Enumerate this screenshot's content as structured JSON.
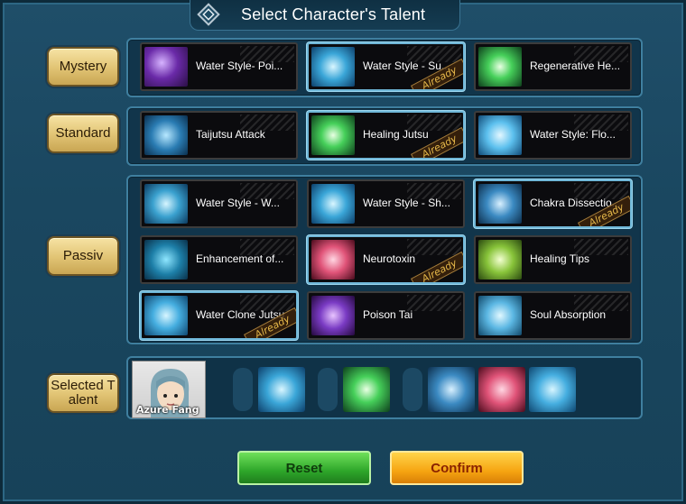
{
  "window": {
    "title": "Select Character's Talent"
  },
  "categories": [
    {
      "label": "Mystery"
    },
    {
      "label": "Standard"
    },
    {
      "label": "Passiv"
    },
    {
      "label": "Selected T alent"
    }
  ],
  "talents": {
    "mystery": [
      {
        "name": "Water Style- Poi...",
        "already": "",
        "icon": "purple-swirl-icon"
      },
      {
        "name": "Water Style - Su...",
        "already": "Already",
        "icon": "water-shark-icon"
      },
      {
        "name": "Regenerative He...",
        "already": "",
        "icon": "green-orb-icon"
      }
    ],
    "standard": [
      {
        "name": "Taijutsu Attack",
        "already": "",
        "icon": "fist-icon"
      },
      {
        "name": "Healing Jutsu",
        "already": "Already",
        "icon": "green-orb-icon"
      },
      {
        "name": "Water Style: Flo...",
        "already": "",
        "icon": "water-vortex-icon"
      }
    ],
    "passive": [
      {
        "name": "Water Style - W...",
        "already": "",
        "icon": "water-dragon-icon"
      },
      {
        "name": "Water Style - Sh...",
        "already": "",
        "icon": "water-shark-icon"
      },
      {
        "name": "Chakra Dissectio...",
        "already": "Already",
        "icon": "glove-hand-icon"
      },
      {
        "name": "Enhancement of...",
        "already": "",
        "icon": "water-kanji-icon"
      },
      {
        "name": "Neurotoxin",
        "already": "Already",
        "icon": "brain-icon"
      },
      {
        "name": "Healing Tips",
        "already": "",
        "icon": "herb-hand-icon"
      },
      {
        "name": "Water Clone Jutsu",
        "already": "Already",
        "icon": "water-clone-icon"
      },
      {
        "name": "Poison Tai",
        "already": "",
        "icon": "poison-blade-icon"
      },
      {
        "name": "Soul Absorption",
        "already": "",
        "icon": "soul-hand-icon"
      }
    ]
  },
  "selected": {
    "character_name": "Azure Fang",
    "slots": [
      "water-shark-icon",
      "green-orb-icon",
      "glove-hand-icon",
      "brain-icon",
      "water-clone-icon"
    ]
  },
  "buttons": {
    "reset": "Reset",
    "confirm": "Confirm"
  },
  "colors": {
    "reset": "#2ea62a",
    "confirm": "#f6a512",
    "label_gold": "#e3c677"
  }
}
